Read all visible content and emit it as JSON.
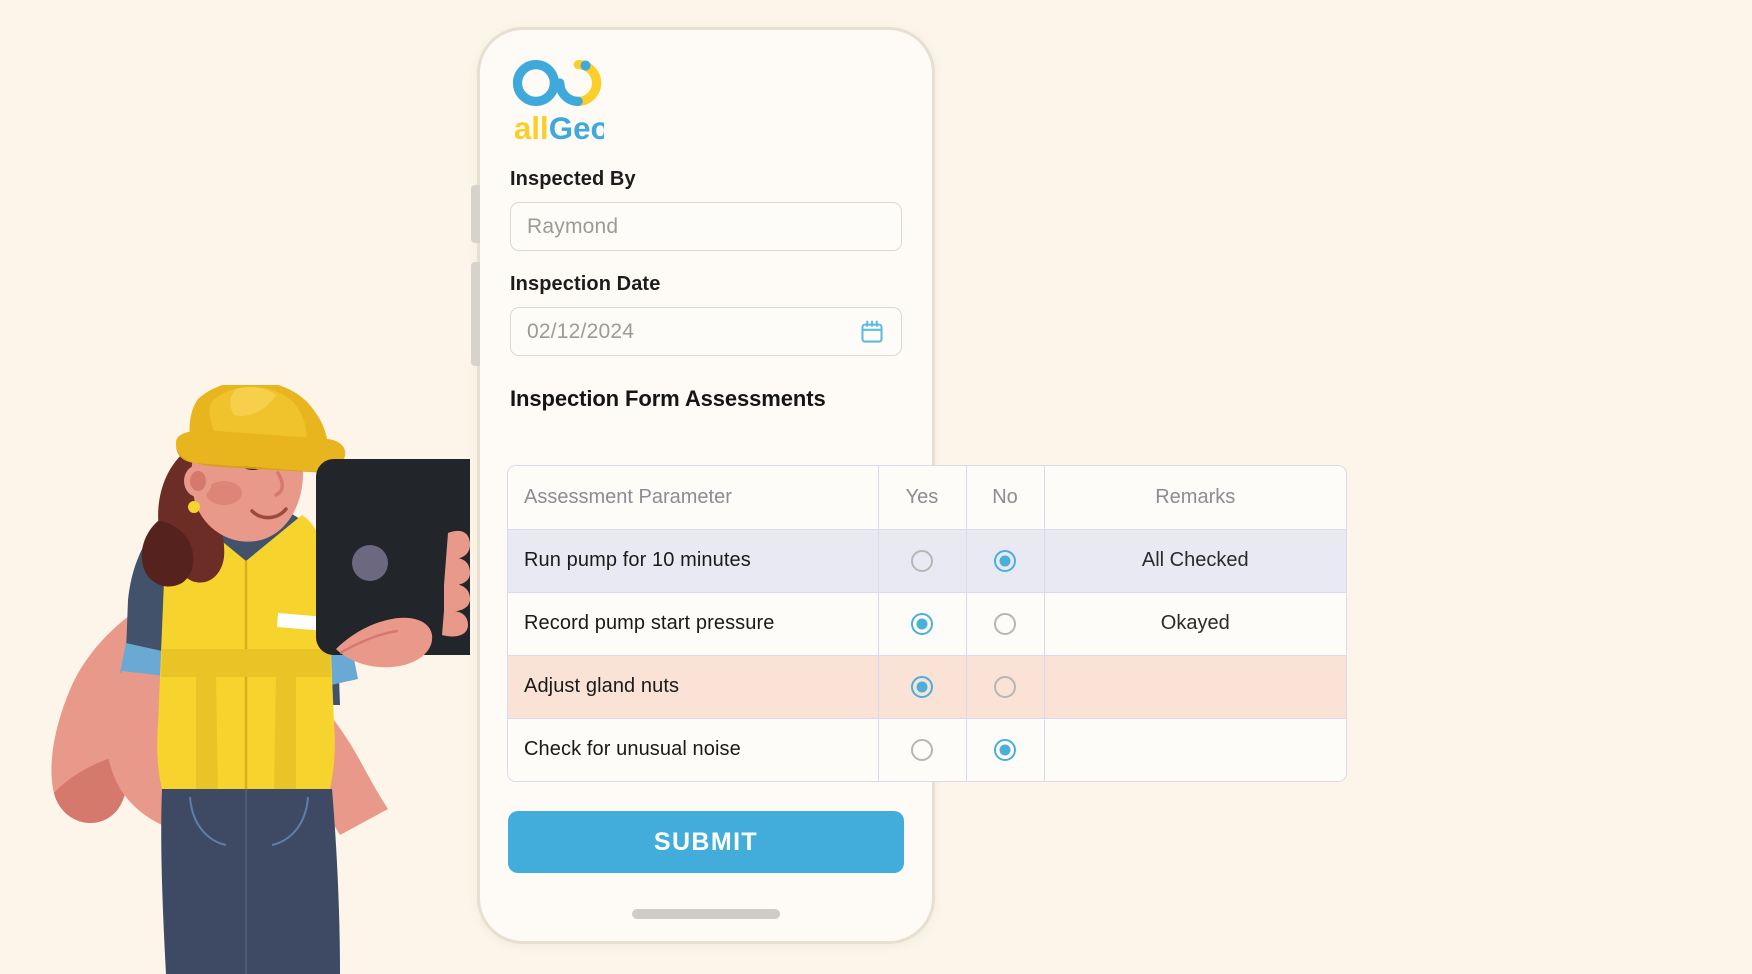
{
  "app": {
    "brand_name": "allGeo",
    "logo_colors": {
      "blue": "#3FA9DC",
      "yellow": "#FCCF28"
    }
  },
  "background_color": "#FDF5E9",
  "accent_color": "#42ADDB",
  "form": {
    "inspected_by": {
      "label": "Inspected By",
      "value": "Raymond",
      "placeholder": "Raymond"
    },
    "inspection_date": {
      "label": "Inspection Date",
      "value": "02/12/2024",
      "placeholder": "02/12/2024",
      "icon": "calendar-icon"
    },
    "section_title": "Inspection Form Assessments",
    "submit_label": "SUBMIT"
  },
  "table": {
    "columns": [
      "Assessment Parameter",
      "Yes",
      "No",
      "Remarks"
    ],
    "rows": [
      {
        "parameter": "Run pump for 10 minutes",
        "yes": false,
        "no": true,
        "remarks": "All Checked",
        "row_style": "row-lav",
        "row_color": "#E9E9F4"
      },
      {
        "parameter": "Record pump start pressure",
        "yes": true,
        "no": false,
        "remarks": "Okayed",
        "row_style": "row-white",
        "row_color": "#FEFCF8"
      },
      {
        "parameter": "Adjust gland nuts",
        "yes": true,
        "no": false,
        "remarks": "",
        "row_style": "row-peach",
        "row_color": "#FAE3D6"
      },
      {
        "parameter": "Check for unusual noise",
        "yes": false,
        "no": true,
        "remarks": "",
        "row_style": "row-white",
        "row_color": "#FEFCF8"
      }
    ]
  },
  "illustration": {
    "name": "female-construction-worker-holding-tablet",
    "helmet_color": "#E8B51F",
    "vest_color": "#F7D32E",
    "shirt_color": "#42526B",
    "pants_color": "#3E4A63",
    "skin_color": "#E9998A",
    "hair_color": "#6B2D26",
    "device_color": "#22252A"
  }
}
